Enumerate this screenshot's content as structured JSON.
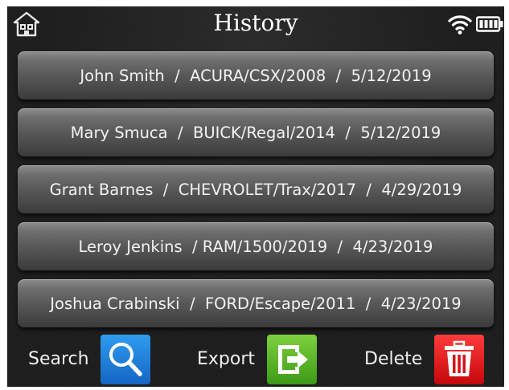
{
  "header": {
    "title": "History"
  },
  "records": [
    {
      "label": "John Smith  /  ACURA/CSX/2008  /  5/12/2019"
    },
    {
      "label": "Mary Smuca  /  BUICK/Regal/2014  /  5/12/2019"
    },
    {
      "label": "Grant Barnes  /  CHEVROLET/Trax/2017  /  4/29/2019"
    },
    {
      "label": "Leroy Jenkins  / RAM/1500/2019  /  4/23/2019"
    },
    {
      "label": "Joshua Crabinski  /  FORD/Escape/2011  /  4/23/2019"
    }
  ],
  "footer": {
    "search_label": "Search",
    "export_label": "Export",
    "delete_label": "Delete"
  },
  "icons": {
    "home": "home-icon",
    "wifi": "wifi-icon",
    "battery": "battery-icon",
    "search": "magnifier-icon",
    "export": "export-arrow-icon",
    "delete": "trash-icon"
  },
  "colors": {
    "search": "#1e7fdc",
    "export": "#5bb62a",
    "delete": "#e31b1b"
  }
}
